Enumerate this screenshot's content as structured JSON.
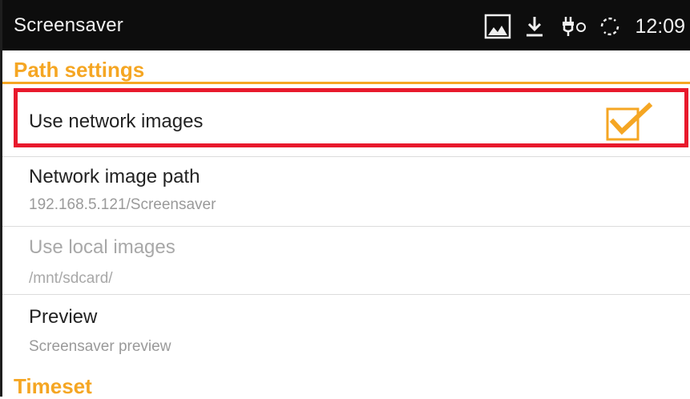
{
  "status_bar": {
    "title": "Screensaver",
    "time": "12:09",
    "icons": [
      "image-icon",
      "download-icon",
      "usb-power-icon",
      "sync-icon"
    ]
  },
  "sections": {
    "path_settings": "Path settings",
    "timeset": "Timeset"
  },
  "settings": {
    "use_network_images": {
      "title": "Use network images",
      "checked": true
    },
    "network_image_path": {
      "title": "Network image path",
      "summary": "192.168.5.121/Screensaver"
    },
    "use_local_images": {
      "title": "Use local images",
      "summary": "/mnt/sdcard/",
      "enabled": false
    },
    "preview": {
      "title": "Preview",
      "summary": "Screensaver preview"
    }
  },
  "colors": {
    "accent": "#f5a623",
    "highlight": "#e8192c",
    "status_bar": "#0d0d0d",
    "summary_text": "#9a9a9a"
  }
}
